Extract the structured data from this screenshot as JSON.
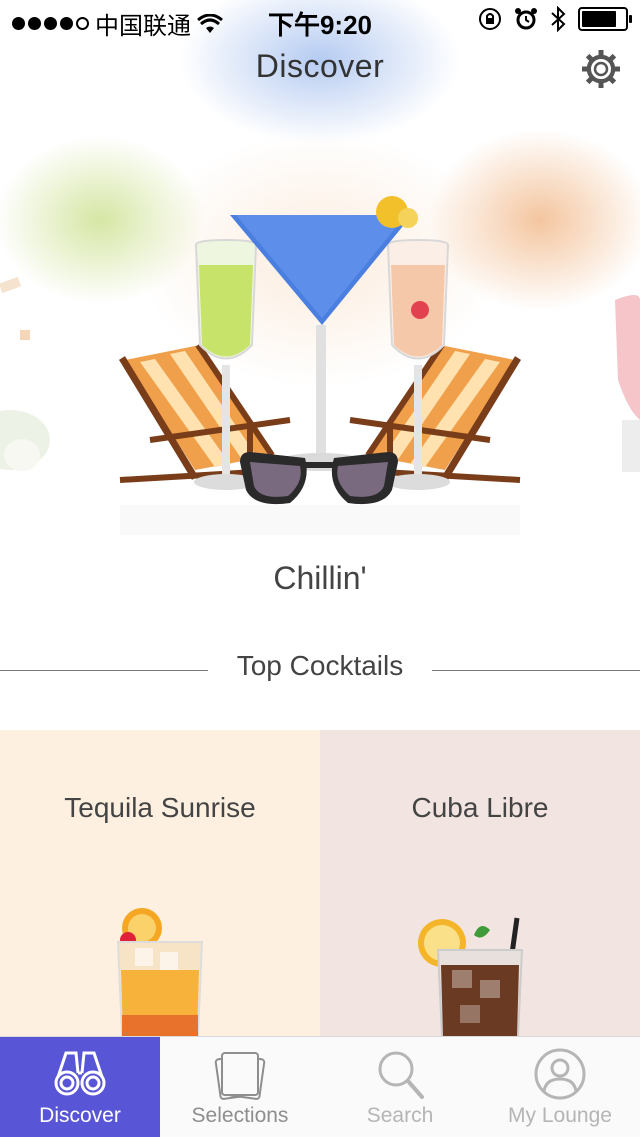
{
  "status_bar": {
    "carrier": "中国联通",
    "time": "下午9:20",
    "signal_dots": 5,
    "signal_filled": 4,
    "battery_level": 0.85
  },
  "nav": {
    "title": "Discover",
    "settings_icon": "gear-icon"
  },
  "hero": {
    "caption": "Chillin'"
  },
  "section": {
    "title": "Top Cocktails"
  },
  "cards": [
    {
      "title": "Tequila Sunrise",
      "background": "#fdf0e1"
    },
    {
      "title": "Cuba Libre",
      "background": "#f2e4e0"
    }
  ],
  "tabs": [
    {
      "label": "Discover",
      "icon": "binoculars-icon",
      "active": true
    },
    {
      "label": "Selections",
      "icon": "cards-stack-icon",
      "active": false
    },
    {
      "label": "Search",
      "icon": "magnifier-icon",
      "active": false
    },
    {
      "label": "My Lounge",
      "icon": "user-circle-icon",
      "active": false
    }
  ],
  "colors": {
    "accent": "#5856d6",
    "text": "#444444"
  }
}
